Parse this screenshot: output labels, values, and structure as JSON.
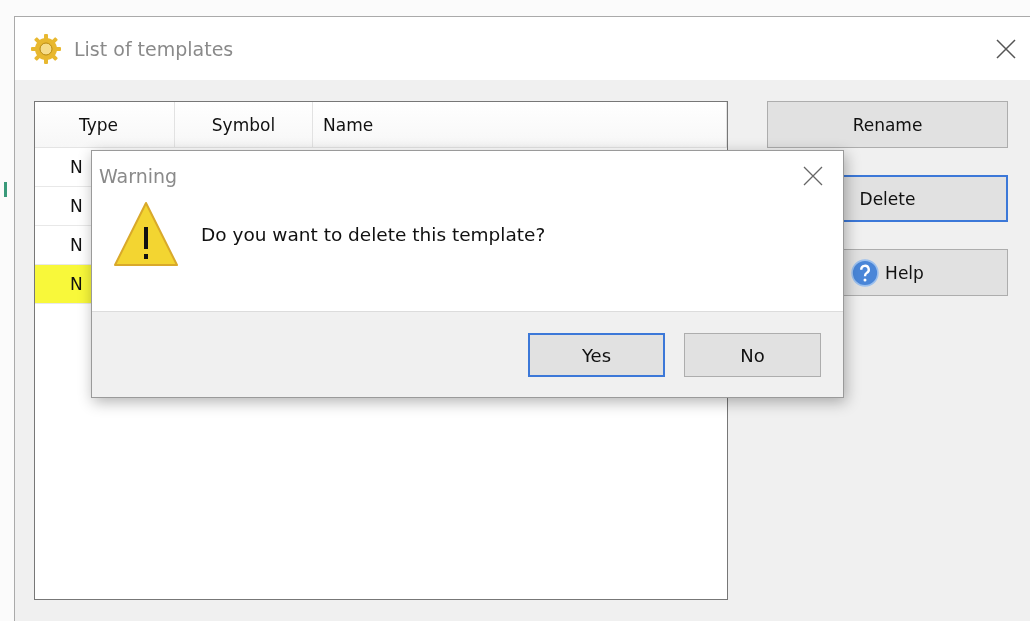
{
  "window": {
    "title": "List of templates"
  },
  "table": {
    "columns": [
      "Type",
      "Symbol",
      "Name"
    ],
    "rows": [
      {
        "type": "N",
        "selected": false
      },
      {
        "type": "N",
        "selected": false
      },
      {
        "type": "N",
        "selected": false
      },
      {
        "type": "N",
        "selected": true
      }
    ]
  },
  "buttons": [
    {
      "label": "Rename",
      "kind": "plain",
      "focused": false
    },
    {
      "label": "Delete",
      "kind": "plain",
      "focused": true
    },
    {
      "label": "Help",
      "kind": "help",
      "focused": false
    }
  ],
  "dialog": {
    "title": "Warning",
    "message": "Do you want to delete this template?",
    "buttons": [
      {
        "label": "Yes",
        "default": true
      },
      {
        "label": "No",
        "default": false
      }
    ]
  }
}
